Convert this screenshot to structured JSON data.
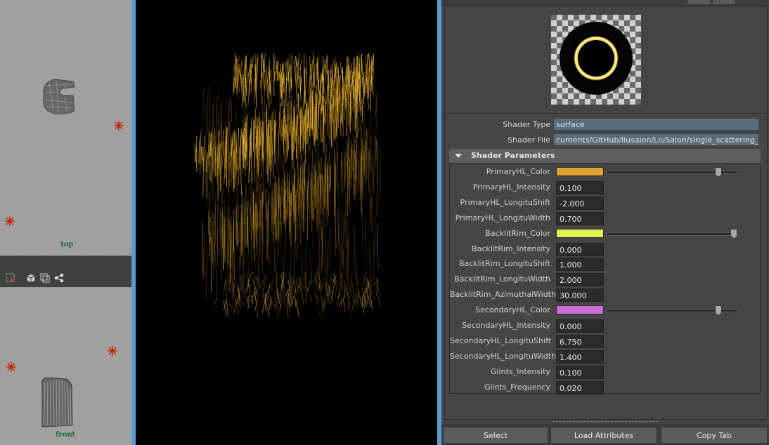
{
  "viewports": {
    "top_label": "top",
    "front_label": "front"
  },
  "shader": {
    "type_label": "Shader Type",
    "type_value": "surface",
    "file_label": "Shader File",
    "file_value": "cuments/GitHub/liusalon/LiuSalon/single_scattering_AFC.sdl"
  },
  "section": {
    "title": "Shader Parameters"
  },
  "params": [
    {
      "label": "PrimaryHL_Color",
      "kind": "color",
      "color": "#dba334",
      "slider": 0.85
    },
    {
      "label": "PrimaryHL_Intensity",
      "kind": "value",
      "value": "0.100"
    },
    {
      "label": "PrimaryHL_LongituShift",
      "kind": "value",
      "value": "-2.000"
    },
    {
      "label": "PrimaryHL_LongituWidth",
      "kind": "value",
      "value": "0.700"
    },
    {
      "label": "BacklitRim_Color",
      "kind": "color",
      "color": "#e3f553",
      "slider": 0.97
    },
    {
      "label": "BacklitRim_Intensity",
      "kind": "value",
      "value": "0.000"
    },
    {
      "label": "BacklitRim_LongituShift",
      "kind": "value",
      "value": "1.000"
    },
    {
      "label": "BacklitRim_LongituWidth",
      "kind": "value",
      "value": "2.000"
    },
    {
      "label": "BacklitRim_AzimuthalWidth",
      "kind": "value",
      "value": "30.000"
    },
    {
      "label": "SecondaryHL_Color",
      "kind": "color",
      "color": "#cd6cd9",
      "slider": 0.85
    },
    {
      "label": "SecondaryHL_Intensity",
      "kind": "value",
      "value": "0.000"
    },
    {
      "label": "SecondaryHL_LongituShift",
      "kind": "value",
      "value": "6.750"
    },
    {
      "label": "SecondaryHL_LongituWidth",
      "kind": "value",
      "value": "1.400"
    },
    {
      "label": "Glints_Intensity",
      "kind": "value",
      "value": "0.100"
    },
    {
      "label": "Glints_Frequency",
      "kind": "value",
      "value": "0.020"
    }
  ],
  "buttons": {
    "select": "Select",
    "load": "Load Attributes",
    "copy": "Copy Tab"
  },
  "colors": {
    "accent_blue": "#5b9bd5",
    "hair_gold": "#d9a52a"
  }
}
